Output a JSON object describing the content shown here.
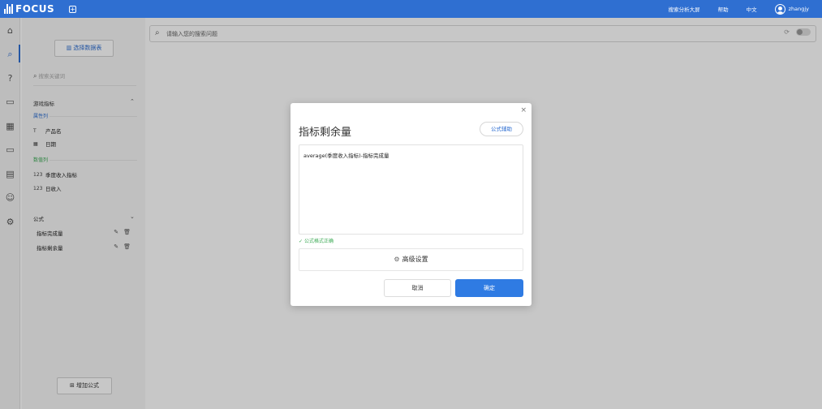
{
  "app": {
    "logo_text": "FOCUS",
    "new_tab_icon": "plus-square-icon",
    "brand_color": "#2f6fd1"
  },
  "topbar": {
    "links": [
      "搜索分析大屏",
      "帮助",
      "中文"
    ],
    "username": "zhangjy"
  },
  "nav": {
    "icons": [
      "home-icon",
      "search-icon",
      "help-icon",
      "board-icon",
      "table-icon",
      "folder-icon",
      "task-icon",
      "user-icon",
      "settings-icon"
    ],
    "active": "search-icon"
  },
  "sidebar": {
    "select_table_label": "选择数据表",
    "search_placeholder": "搜索关键词",
    "group_title": "游戏指标",
    "attr_label": "属性列",
    "measure_label": "数值列",
    "attr_fields": [
      {
        "type": "T",
        "name": "产品名"
      },
      {
        "type": "cal",
        "name": "日期"
      }
    ],
    "measure_fields": [
      {
        "type": "123",
        "name": "季度收入指标"
      },
      {
        "type": "123",
        "name": "日收入"
      }
    ],
    "formula_title": "公式",
    "formulas": [
      "指标完成量",
      "指标剩余量"
    ],
    "add_formula_label": "增加公式"
  },
  "main": {
    "search_placeholder": "请输入您的搜索问题"
  },
  "dialog": {
    "title": "指标剩余量",
    "help_button": "公式辅助",
    "formula_text": "average(季度收入指标)-指标完成量",
    "valid_text": "公式格式正确",
    "advanced_label": "高级设置",
    "cancel_label": "取消",
    "ok_label": "确定",
    "ok_color": "#2f7be3",
    "valid_color": "#3caa55"
  }
}
